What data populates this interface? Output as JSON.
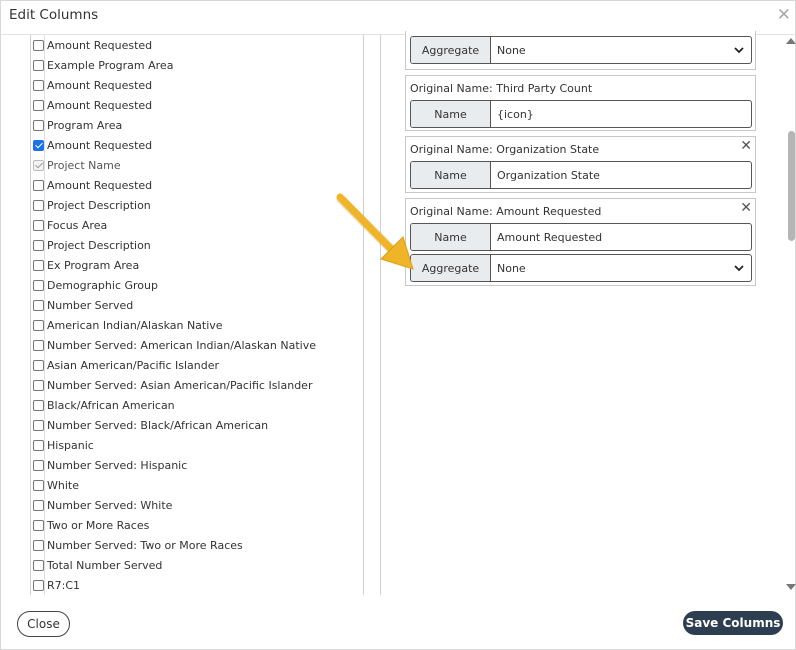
{
  "dialog": {
    "title": "Edit Columns",
    "close_icon": "close-icon"
  },
  "available_columns": [
    {
      "label": "Amount Requested",
      "checked": false,
      "disabled": false
    },
    {
      "label": "Example Program Area",
      "checked": false,
      "disabled": false
    },
    {
      "label": "Amount Requested",
      "checked": false,
      "disabled": false
    },
    {
      "label": "Amount Requested",
      "checked": false,
      "disabled": false
    },
    {
      "label": "Program Area",
      "checked": false,
      "disabled": false
    },
    {
      "label": "Amount Requested",
      "checked": true,
      "disabled": false
    },
    {
      "label": "Project Name",
      "checked": true,
      "disabled": true
    },
    {
      "label": "Amount Requested",
      "checked": false,
      "disabled": false
    },
    {
      "label": "Project Description",
      "checked": false,
      "disabled": false
    },
    {
      "label": "Focus Area",
      "checked": false,
      "disabled": false
    },
    {
      "label": "Project Description",
      "checked": false,
      "disabled": false
    },
    {
      "label": "Ex Program Area",
      "checked": false,
      "disabled": false
    },
    {
      "label": "Demographic Group",
      "checked": false,
      "disabled": false
    },
    {
      "label": "Number Served",
      "checked": false,
      "disabled": false
    },
    {
      "label": "American Indian/Alaskan Native",
      "checked": false,
      "disabled": false
    },
    {
      "label": "Number Served: American Indian/Alaskan Native",
      "checked": false,
      "disabled": false
    },
    {
      "label": "Asian American/Pacific Islander",
      "checked": false,
      "disabled": false
    },
    {
      "label": "Number Served: Asian American/Pacific Islander",
      "checked": false,
      "disabled": false
    },
    {
      "label": "Black/African American",
      "checked": false,
      "disabled": false
    },
    {
      "label": "Number Served: Black/African American",
      "checked": false,
      "disabled": false
    },
    {
      "label": "Hispanic",
      "checked": false,
      "disabled": false
    },
    {
      "label": "Number Served: Hispanic",
      "checked": false,
      "disabled": false
    },
    {
      "label": "White",
      "checked": false,
      "disabled": false
    },
    {
      "label": "Number Served: White",
      "checked": false,
      "disabled": false
    },
    {
      "label": "Two or More Races",
      "checked": false,
      "disabled": false
    },
    {
      "label": "Number Served: Two or More Races",
      "checked": false,
      "disabled": false
    },
    {
      "label": "Total Number Served",
      "checked": false,
      "disabled": false
    },
    {
      "label": "R7:C1",
      "checked": false,
      "disabled": false
    }
  ],
  "selected_columns": {
    "partial_card": {
      "aggregate_label": "Aggregate",
      "aggregate_value": "None"
    },
    "cards": [
      {
        "original_prefix": "Original Name: ",
        "original_name": "Third Party Count",
        "name_label": "Name",
        "name_value": "{icon}",
        "removable": false
      },
      {
        "original_prefix": "Original Name: ",
        "original_name": "Organization State",
        "name_label": "Name",
        "name_value": "Organization State",
        "removable": true
      },
      {
        "original_prefix": "Original Name: ",
        "original_name": "Amount Requested",
        "name_label": "Name",
        "name_value": "Amount Requested",
        "aggregate_label": "Aggregate",
        "aggregate_value": "None",
        "removable": true
      }
    ]
  },
  "annotation": {
    "icon": "arrow-pointer-icon",
    "color": "#F0B429"
  },
  "footer": {
    "close_label": "Close",
    "save_label": "Save Columns"
  },
  "colors": {
    "save_button": "#2C3E50",
    "checkbox_checked": "#1A73E8"
  }
}
